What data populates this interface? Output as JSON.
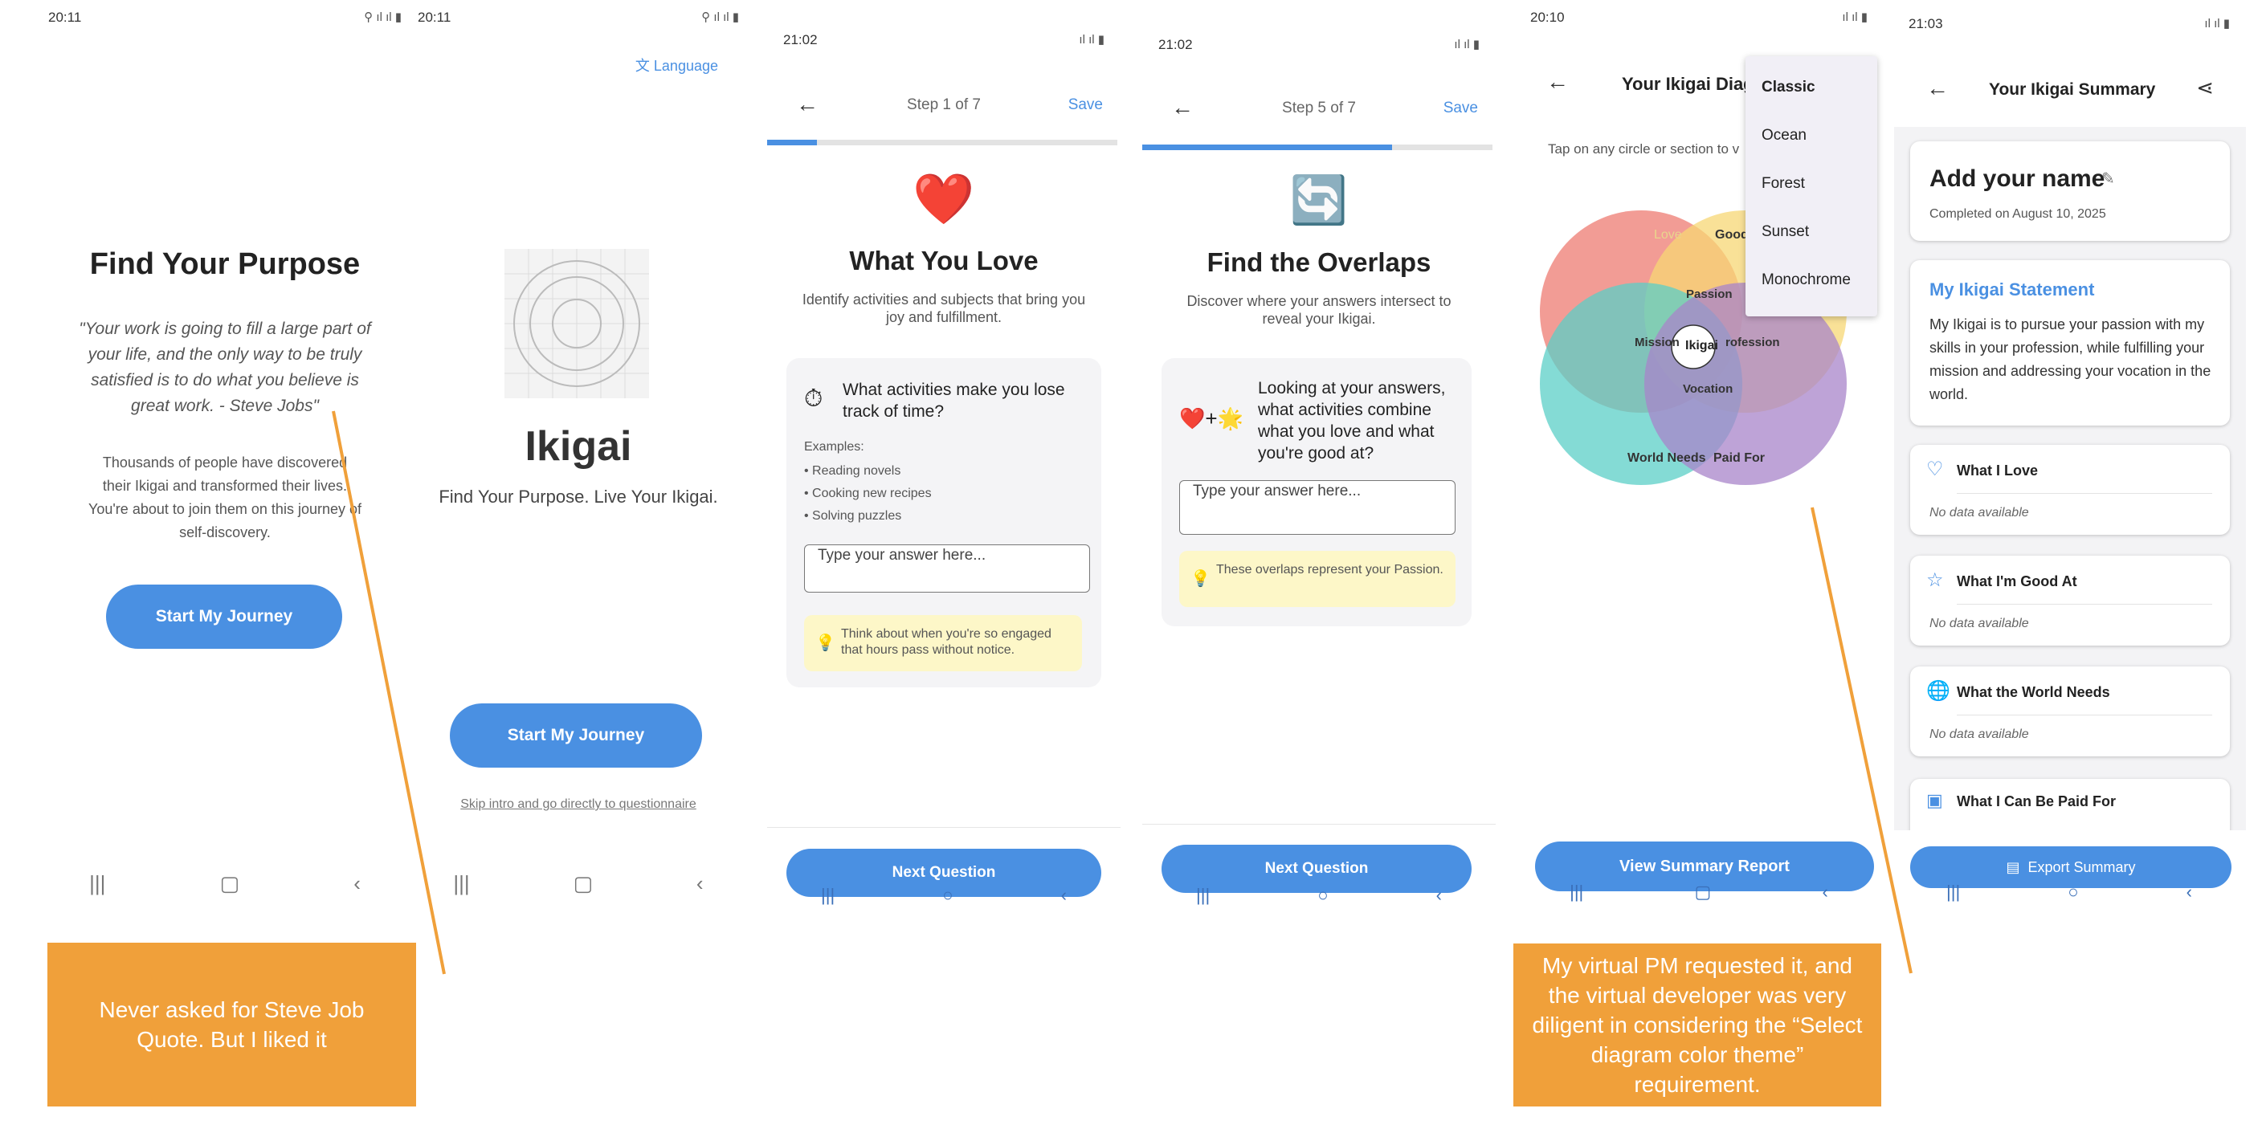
{
  "s1": {
    "status_time": "20:11",
    "title": "Find Your Purpose",
    "quote": "\"Your work is going to fill a large part of your life, and the only way to be truly satisfied is to do what you believe is great work. - Steve Jobs\"",
    "desc": "Thousands of people have discovered their Ikigai and transformed their lives. You're about to join them on this journey of self-discovery.",
    "button": "Start My Journey"
  },
  "s2": {
    "status_time": "20:11",
    "language": "Language",
    "app_name": "Ikigai",
    "tagline": "Find Your Purpose. Live Your Ikigai.",
    "button": "Start My Journey",
    "skip": "Skip intro and go directly to questionnaire"
  },
  "s3": {
    "status_time": "21:02",
    "step": "Step 1 of 7",
    "save": "Save",
    "progress": 0.143,
    "emoji": "❤️",
    "title": "What You Love",
    "subtitle": "Identify activities and subjects that bring you joy and fulfillment.",
    "question": "What activities make you lose track of time?",
    "examples_label": "Examples:",
    "examples": [
      "• Reading novels",
      "• Cooking new recipes",
      "• Solving puzzles"
    ],
    "placeholder": "Type your answer here...",
    "tip": "Think about when you're so engaged that hours pass without notice.",
    "button": "Next Question"
  },
  "s4": {
    "status_time": "21:02",
    "step": "Step 5 of 7",
    "save": "Save",
    "progress": 0.714,
    "emoji": "🔄",
    "title": "Find the Overlaps",
    "subtitle": "Discover where your answers intersect to reveal your Ikigai.",
    "q_emoji": "❤️+🌟",
    "question": "Looking at your answers, what activities combine what you love and what you're good at?",
    "placeholder": "Type your answer here...",
    "tip": "These overlaps represent your Passion.",
    "button": "Next Question"
  },
  "s5": {
    "status_time": "20:10",
    "title": "Your Ikigai Diag",
    "hint": "Tap on any circle or section to v",
    "labels": {
      "love": "Love",
      "good": "Good",
      "passion": "Passion",
      "mission": "Mission",
      "profession": "rofession",
      "ikigai": "Ikigai",
      "vocation": "Vocation",
      "world": "World Needs",
      "paid": "Paid For"
    },
    "menu": [
      "Classic",
      "Ocean",
      "Forest",
      "Sunset",
      "Monochrome"
    ],
    "button": "View Summary Report",
    "colors": {
      "love": "#ee7b72",
      "good": "#f7d774",
      "world": "#5bcfc7",
      "paid": "#a884c9"
    }
  },
  "s6": {
    "status_time": "21:03",
    "title": "Your Ikigai Summary",
    "name": "Add your name",
    "completed": "Completed on August 10, 2025",
    "statement_title": "My Ikigai Statement",
    "statement": "My Ikigai is to pursue your passion with my skills in your profession, while fulfilling your mission and addressing your vocation in the world.",
    "sections": [
      {
        "title": "What I Love",
        "empty": "No data available"
      },
      {
        "title": "What I'm Good At",
        "empty": "No data available"
      },
      {
        "title": "What the World Needs",
        "empty": "No data available"
      },
      {
        "title": "What I Can Be Paid For",
        "empty": ""
      }
    ],
    "button": "Export Summary"
  },
  "notes": {
    "left": "Never asked for Steve Job Quote. But I liked it",
    "right": "My virtual PM requested it, and the virtual developer was very diligent in considering the “Select diagram color theme” requirement."
  }
}
